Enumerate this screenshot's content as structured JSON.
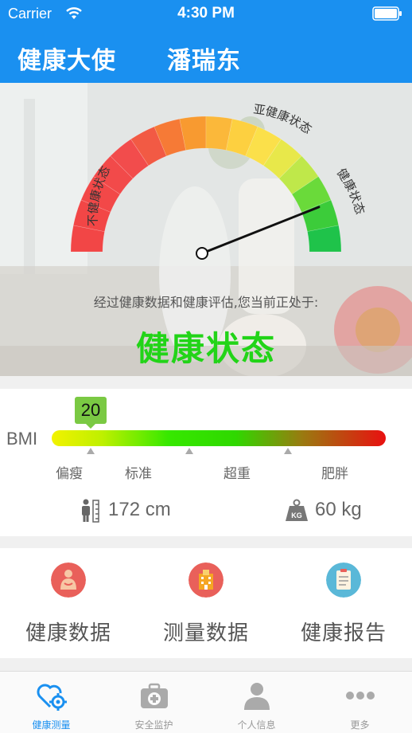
{
  "status_bar": {
    "carrier": "Carrier",
    "time": "4:30 PM"
  },
  "nav": {
    "title": "健康大使",
    "user": "潘瑞东"
  },
  "gauge": {
    "label_unhealthy": "不健康状态",
    "label_subhealthy": "亚健康状态",
    "label_healthy": "健康状态",
    "pointer_fraction": 0.88
  },
  "hero": {
    "subtitle": "经过健康数据和健康评估,您当前正处于:",
    "status": "健康状态",
    "status_color": "#22d418"
  },
  "bmi": {
    "label": "BMI",
    "value": "20",
    "categories": [
      "偏瘦",
      "标准",
      "超重",
      "肥胖"
    ],
    "height": "172 cm",
    "weight": "60 kg",
    "weight_icon_text": "KG"
  },
  "menu": {
    "items": [
      {
        "label": "健康数据",
        "icon": "body-chart-icon",
        "color": "#e9605a"
      },
      {
        "label": "测量数据",
        "icon": "hospital-icon",
        "color": "#e9605a"
      },
      {
        "label": "健康报告",
        "icon": "clipboard-icon",
        "color": "#5ab8d8"
      }
    ]
  },
  "tabs": [
    {
      "label": "健康测量",
      "icon": "heart-gear-icon",
      "active": true
    },
    {
      "label": "安全监护",
      "icon": "first-aid-kit-icon",
      "active": false
    },
    {
      "label": "个人信息",
      "icon": "person-icon",
      "active": false
    },
    {
      "label": "更多",
      "icon": "more-dots-icon",
      "active": false
    }
  ],
  "colors": {
    "accent": "#1a90f0",
    "healthy": "#22d418"
  }
}
